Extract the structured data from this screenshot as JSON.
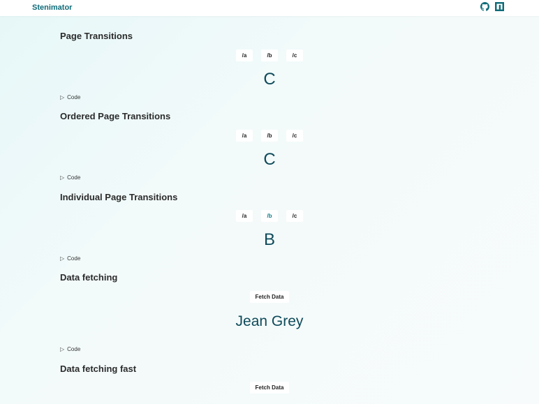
{
  "header": {
    "brand": "Stenimator",
    "icons": [
      "github-icon",
      "npm-icon"
    ]
  },
  "sections": [
    {
      "title": "Page Transitions",
      "nav": [
        "/a",
        "/b",
        "/c"
      ],
      "active_index": -1,
      "display": "C",
      "code_label": "Code"
    },
    {
      "title": "Ordered Page Transitions",
      "nav": [
        "/a",
        "/b",
        "/c"
      ],
      "active_index": -1,
      "display": "C",
      "code_label": "Code"
    },
    {
      "title": "Individual Page Transitions",
      "nav": [
        "/a",
        "/b",
        "/c"
      ],
      "active_index": 1,
      "display": "B",
      "code_label": "Code"
    },
    {
      "title": "Data fetching",
      "button": "Fetch Data",
      "display": "Jean Grey",
      "code_label": "Code"
    },
    {
      "title": "Data fetching fast",
      "button": "Fetch Data"
    }
  ],
  "colors": {
    "brand": "#0f6b78",
    "active_link": "#0f7c8a",
    "display_text": "#0e4a5a"
  }
}
